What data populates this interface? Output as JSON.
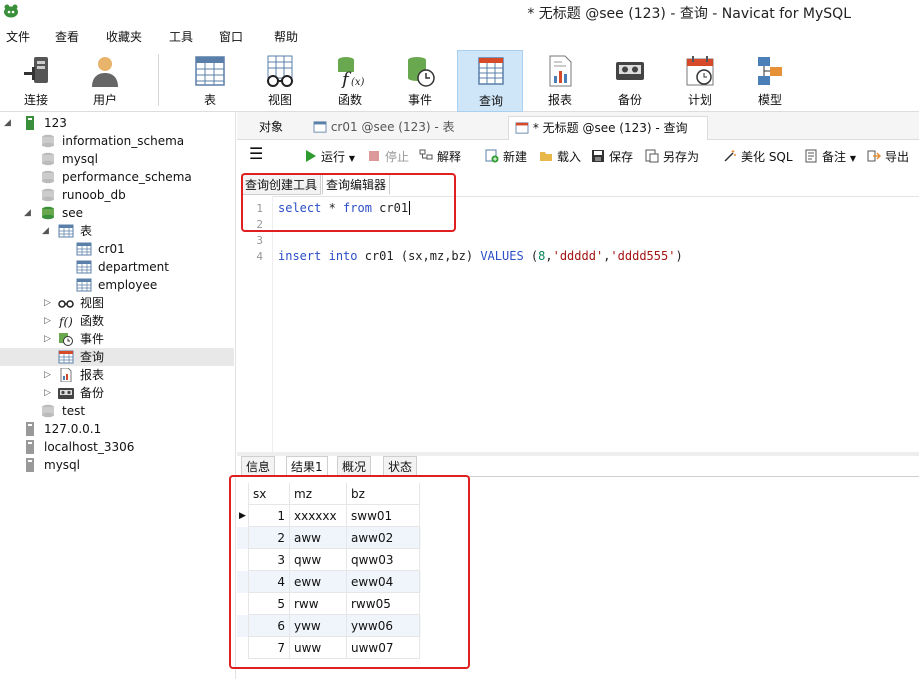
{
  "window": {
    "title": "* 无标题 @see (123) - 查询 - Navicat for MySQL"
  },
  "menu": [
    "文件",
    "查看",
    "收藏夹",
    "工具",
    "窗口",
    "帮助"
  ],
  "toolbar": {
    "connect": "连接",
    "user": "用户",
    "table": "表",
    "view": "视图",
    "function": "函数",
    "event": "事件",
    "query": "查询",
    "report": "报表",
    "backup": "备份",
    "schedule": "计划",
    "model": "模型"
  },
  "tree": {
    "conn1": "123",
    "dbs": [
      "information_schema",
      "mysql",
      "performance_schema",
      "runoob_db"
    ],
    "see": "see",
    "tables_folder": "表",
    "tables": [
      "cr01",
      "department",
      "employee"
    ],
    "views": "视图",
    "functions": "函数",
    "events": "事件",
    "queries": "查询",
    "reports": "报表",
    "backups": "备份",
    "test": "test",
    "conn2": "127.0.0.1",
    "conn3": "localhost_3306",
    "conn4": "mysql"
  },
  "tabs": {
    "objects": "对象",
    "table_tab": "cr01 @see (123) - 表",
    "query_tab": "* 无标题 @see (123) - 查询"
  },
  "qtoolbar": {
    "run": "运行",
    "stop": "停止",
    "explain": "解释",
    "new": "新建",
    "load": "载入",
    "save": "保存",
    "save_as": "另存为",
    "beautify": "美化 SQL",
    "notes": "备注",
    "export": "导出"
  },
  "subtabs": {
    "builder": "查询创建工具",
    "editor": "查询编辑器"
  },
  "editor": {
    "line_numbers": [
      "1",
      "2",
      "3",
      "4"
    ],
    "line1": {
      "kw1": "select",
      "rest1": " * ",
      "kw2": "from",
      "rest2": " cr01"
    },
    "line4": {
      "kw1": "insert",
      "sp": " ",
      "kw2": "into",
      "mid": " cr01 (sx,mz,bz) ",
      "kw3": "VALUES",
      "p1": " (",
      "num": "8",
      "c1": ",",
      "s1": "'ddddd'",
      "c2": ",",
      "s2": "'dddd555'",
      "p2": ")"
    }
  },
  "result_tabs": {
    "info": "信息",
    "result": "结果1",
    "profile": "概况",
    "status": "状态"
  },
  "grid": {
    "columns": [
      "sx",
      "mz",
      "bz"
    ],
    "rows": [
      [
        "1",
        "xxxxxx",
        "sww01"
      ],
      [
        "2",
        "aww",
        "aww02"
      ],
      [
        "3",
        "qww",
        "qww03"
      ],
      [
        "4",
        "eww",
        "eww04"
      ],
      [
        "5",
        "rww",
        "rww05"
      ],
      [
        "6",
        "yww",
        "yww06"
      ],
      [
        "7",
        "uww",
        "uww07"
      ]
    ]
  }
}
